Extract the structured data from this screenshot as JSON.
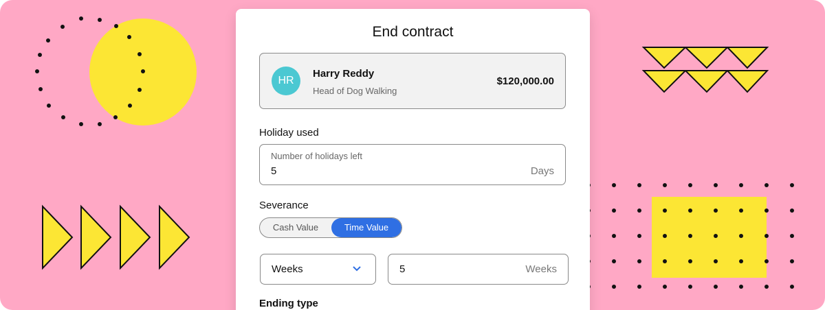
{
  "modal": {
    "title": "End contract"
  },
  "employee": {
    "initials": "HR",
    "name": "Harry Reddy",
    "role": "Head of Dog Walking",
    "salary": "$120,000.00",
    "avatar_color": "#4bc8d2"
  },
  "holiday": {
    "section_label": "Holiday used",
    "caption": "Number of holidays left",
    "value": "5",
    "unit": "Days"
  },
  "severance": {
    "section_label": "Severance",
    "options": [
      "Cash Value",
      "Time Value"
    ],
    "selected": "Time Value",
    "period_select": "Weeks",
    "period_value": "5",
    "period_unit": "Weeks"
  },
  "ending_type": {
    "section_label": "Ending type"
  },
  "colors": {
    "background": "#ffa8c5",
    "accent_yellow": "#fce634",
    "primary_blue": "#2f6fe3"
  }
}
